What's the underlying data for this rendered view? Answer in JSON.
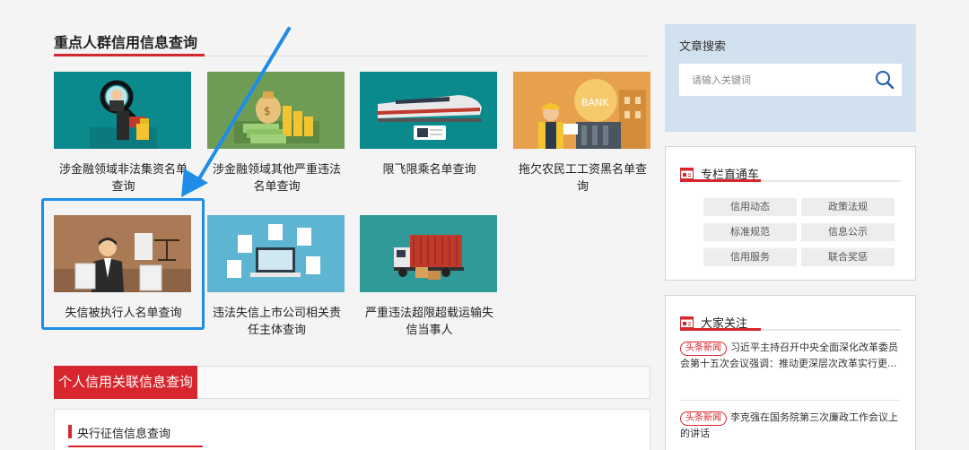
{
  "main": {
    "section_title": "重点人群信用信息查询",
    "cards": [
      {
        "label": "涉金融领域非法集资名单查询",
        "color": "#0b8a8e"
      },
      {
        "label": "涉金融领域其他严重违法名单查询",
        "color": "#6f9c55"
      },
      {
        "label": "限飞限乘名单查询",
        "color": "#0b8a8e"
      },
      {
        "label": "拖欠农民工工资黑名单查询",
        "color": "#e7a04b"
      },
      {
        "label": "失信被执行人名单查询",
        "color": "#a97a55"
      },
      {
        "label": "违法失信上市公司相关责任主体查询",
        "color": "#5db5d2"
      },
      {
        "label": "严重违法超限超载运输失信当事人",
        "color": "#2f9a98"
      }
    ],
    "bank_sign": "BANK",
    "personal_tab": "个人信用关联信息查询",
    "personal_sub": "央行征信信息查询"
  },
  "sidebar": {
    "search_label": "文章搜索",
    "search_placeholder": "请输入关键词",
    "column": {
      "title": "专栏直通车",
      "items": [
        "信用动态",
        "政策法规",
        "标准规范",
        "信息公示",
        "信用服务",
        "联合奖惩"
      ]
    },
    "focus": {
      "title": "大家关注",
      "news": [
        {
          "tag": "头条新闻",
          "text": "习近平主持召开中央全面深化改革委员会第十五次会议强调：推动更深层次改革实行更..."
        },
        {
          "tag": "头条新闻",
          "text": "李克强在国务院第三次廉政工作会议上的讲话"
        }
      ]
    }
  },
  "colors": {
    "accent": "#d7262d",
    "highlight": "#1e8ce8",
    "search_panel": "#d2e1ef"
  }
}
